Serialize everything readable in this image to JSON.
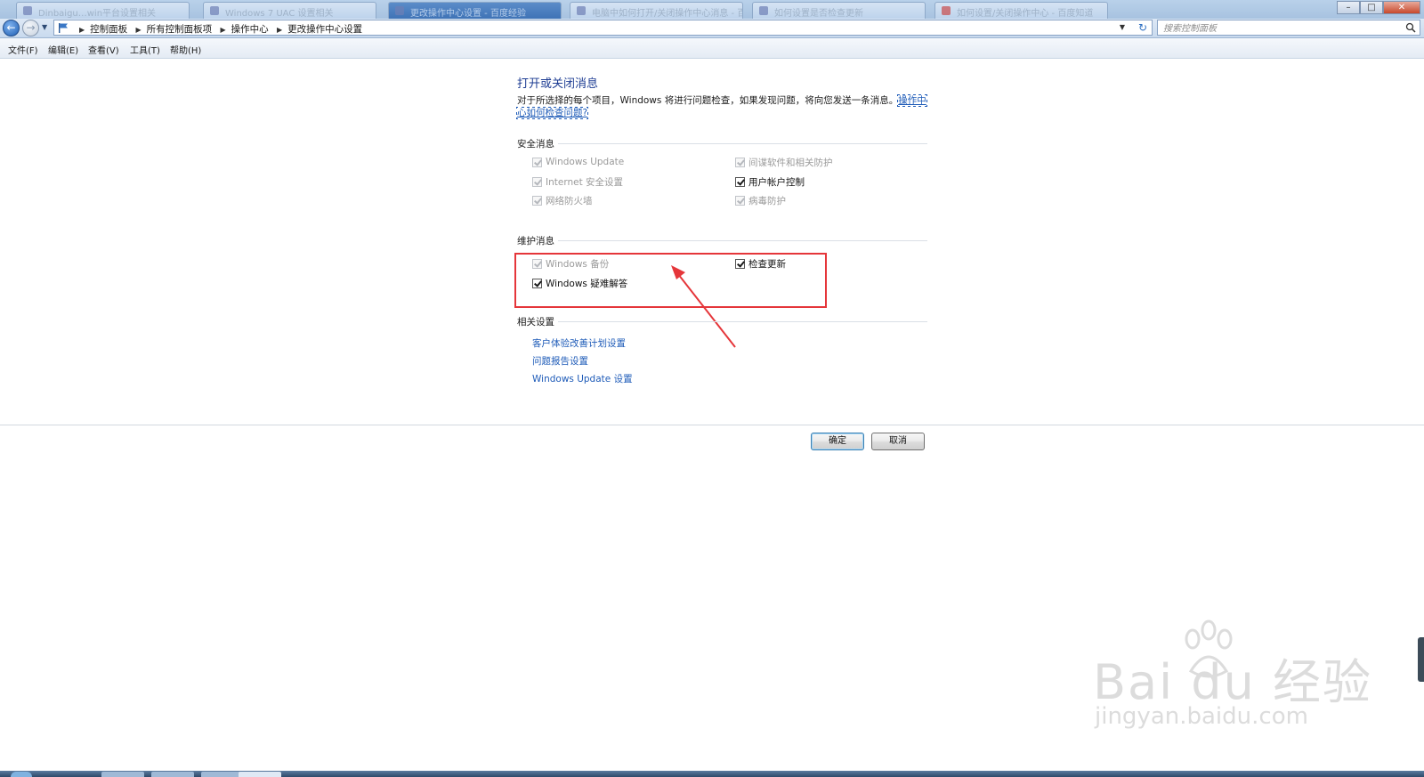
{
  "browser": {
    "tabs": [
      {
        "label": "Dinbaigu…win平台设置相关"
      },
      {
        "label": "Windows 7 UAC 设置相关"
      },
      {
        "label": "更改操作中心设置 - 百度经验"
      },
      {
        "label": "电脑中如何打开/关闭操作中心消息 - 百度经验"
      },
      {
        "label": "如何设置是否检查更新"
      },
      {
        "label": "如何设置/关闭操作中心 - 百度知道"
      }
    ],
    "window_buttons": {
      "minimize": "–",
      "maximize": "□",
      "close": "✕"
    }
  },
  "addressbar": {
    "breadcrumbs": [
      "控制面板",
      "所有控制面板项",
      "操作中心",
      "更改操作中心设置"
    ],
    "search_placeholder": "搜索控制面板"
  },
  "menu": {
    "items": [
      "文件(F)",
      "编辑(E)",
      "查看(V)",
      "工具(T)",
      "帮助(H)"
    ]
  },
  "main": {
    "title": "打开或关闭消息",
    "description": "对于所选择的每个项目，Windows 将进行问题检查，如果发现问题，将向您发送一条消息。",
    "help_link": "操作中心如何检查问题?",
    "security": {
      "title": "安全消息",
      "items": [
        {
          "label": "Windows Update",
          "checked": true,
          "enabled": false
        },
        {
          "label": "间谍软件和相关防护",
          "checked": true,
          "enabled": false
        },
        {
          "label": "Internet 安全设置",
          "checked": true,
          "enabled": false
        },
        {
          "label": "用户帐户控制",
          "checked": true,
          "enabled": true
        },
        {
          "label": "网络防火墙",
          "checked": true,
          "enabled": false
        },
        {
          "label": "病毒防护",
          "checked": true,
          "enabled": false
        }
      ]
    },
    "maintenance": {
      "title": "维护消息",
      "items": [
        {
          "label": "Windows 备份",
          "checked": true,
          "enabled": false
        },
        {
          "label": "检查更新",
          "checked": true,
          "enabled": true
        },
        {
          "label": "Windows 疑难解答",
          "checked": true,
          "enabled": true
        }
      ]
    },
    "related": {
      "title": "相关设置",
      "links": [
        "客户体验改善计划设置",
        "问题报告设置",
        "Windows Update 设置"
      ]
    }
  },
  "buttons": {
    "ok": "确定",
    "cancel": "取消"
  },
  "watermark": {
    "logo": "Bai du 经验",
    "url": "jingyan.baidu.com"
  },
  "colors": {
    "accent_link": "#1e5bb8",
    "title": "#1e3d93",
    "highlight": "#e5363a"
  }
}
